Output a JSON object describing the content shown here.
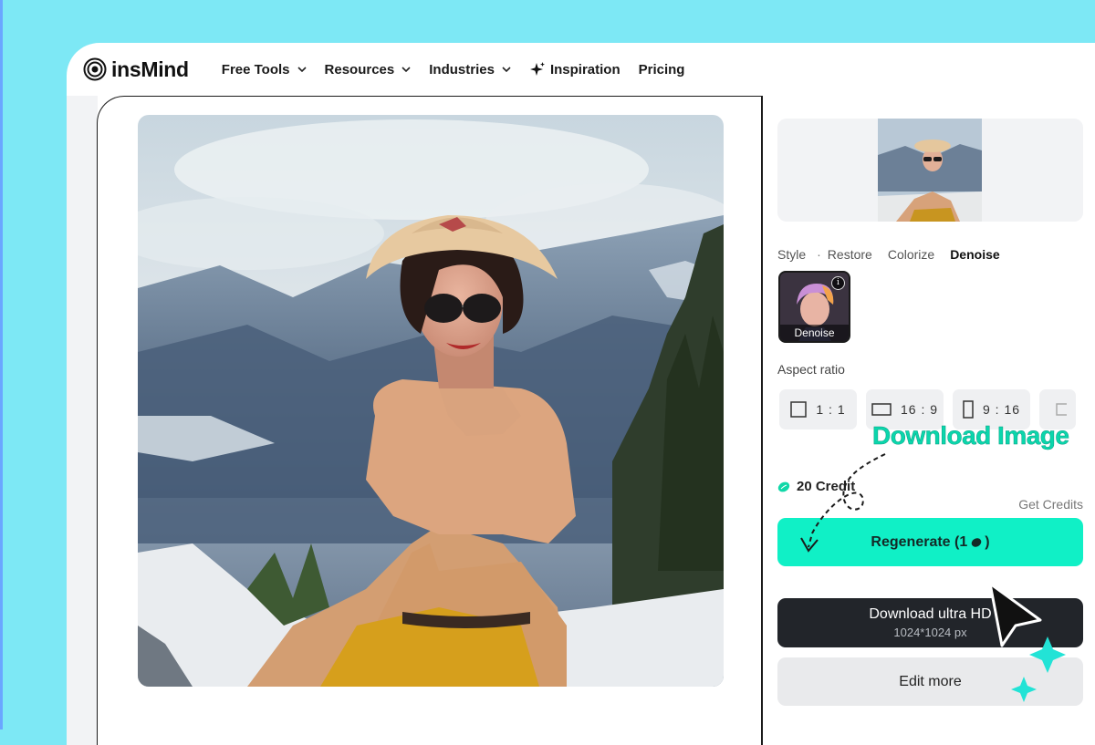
{
  "app": {
    "brand": "insMind"
  },
  "nav": {
    "items": [
      {
        "label": "Free Tools",
        "has_dropdown": true
      },
      {
        "label": "Resources",
        "has_dropdown": true
      },
      {
        "label": "Industries",
        "has_dropdown": true
      },
      {
        "label": "Inspiration",
        "icon": "sparkle-icon"
      },
      {
        "label": "Pricing"
      }
    ]
  },
  "panel": {
    "tabs": [
      "Style",
      "Restore",
      "Colorize",
      "Denoise"
    ],
    "active_tab": "Denoise",
    "style_card_label": "Denoise",
    "aspect_label": "Aspect ratio",
    "ratios": [
      "1 : 1",
      "16 : 9",
      "9 : 16"
    ],
    "credit_text": "20 Credit",
    "get_credits": "Get Credits",
    "regenerate_label": "Regenerate (1",
    "regenerate_suffix": ")",
    "download_label": "Download ultra HD",
    "download_sub": "1024*1024 px",
    "edit_label": "Edit more"
  },
  "callout": {
    "text": "Download Image"
  },
  "colors": {
    "background": "#7de8f5",
    "accent": "#10f0c6",
    "dark_button": "#22252a"
  }
}
